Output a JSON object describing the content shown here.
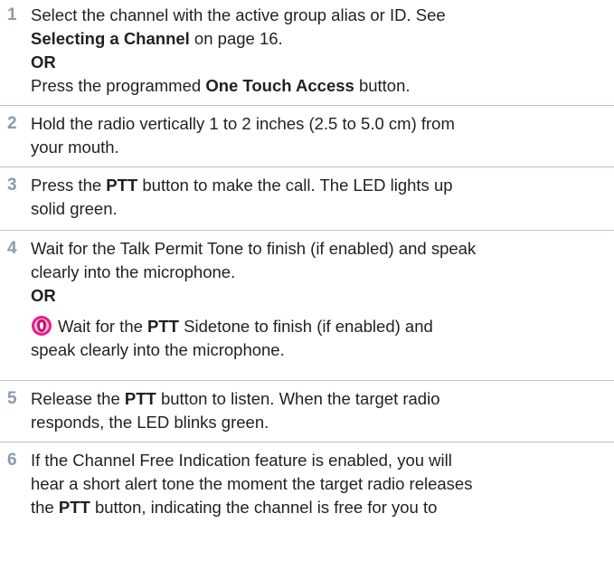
{
  "steps": [
    {
      "number": "1",
      "line1": "Select the channel with the active group alias or ID. See",
      "line2_bold": "Selecting a Channel",
      "line2_rest": " on page 16.",
      "or": "OR",
      "line4_pre": "Press the programmed ",
      "line4_bold": "One Touch Access",
      "line4_post": " button."
    },
    {
      "number": "2",
      "line1": "Hold the radio vertically 1 to 2 inches (2.5 to 5.0 cm) from",
      "line2": "your mouth."
    },
    {
      "number": "3",
      "line1_pre": "Press the ",
      "line1_bold": "PTT",
      "line1_post": " button to make the call. The LED lights up",
      "line2": "solid green."
    },
    {
      "number": "4",
      "line1": "Wait for the Talk Permit Tone to finish (if enabled) and speak",
      "line2": "clearly into the microphone.",
      "or": "OR",
      "line4_pre": "Wait for the ",
      "line4_bold": "PTT",
      "line4_post": " Sidetone to finish (if enabled) and",
      "line5": "speak clearly into the microphone.",
      "icon": "feature-icon"
    },
    {
      "number": "5",
      "line1_pre": "Release the ",
      "line1_bold": "PTT",
      "line1_post": " button to listen. When the target radio",
      "line2": "responds, the LED blinks green."
    },
    {
      "number": "6",
      "line1": "If the Channel Free Indication feature is enabled, you will",
      "line2": "hear a short alert tone the moment the target radio releases",
      "line3_pre": "the ",
      "line3_bold": "PTT",
      "line3_post": " button, indicating the channel is free for you to"
    }
  ],
  "colors": {
    "step_number": "#8b9aae",
    "divider": "#b9c4d0",
    "text": "#231f20",
    "icon_ring": "#e0218a"
  }
}
